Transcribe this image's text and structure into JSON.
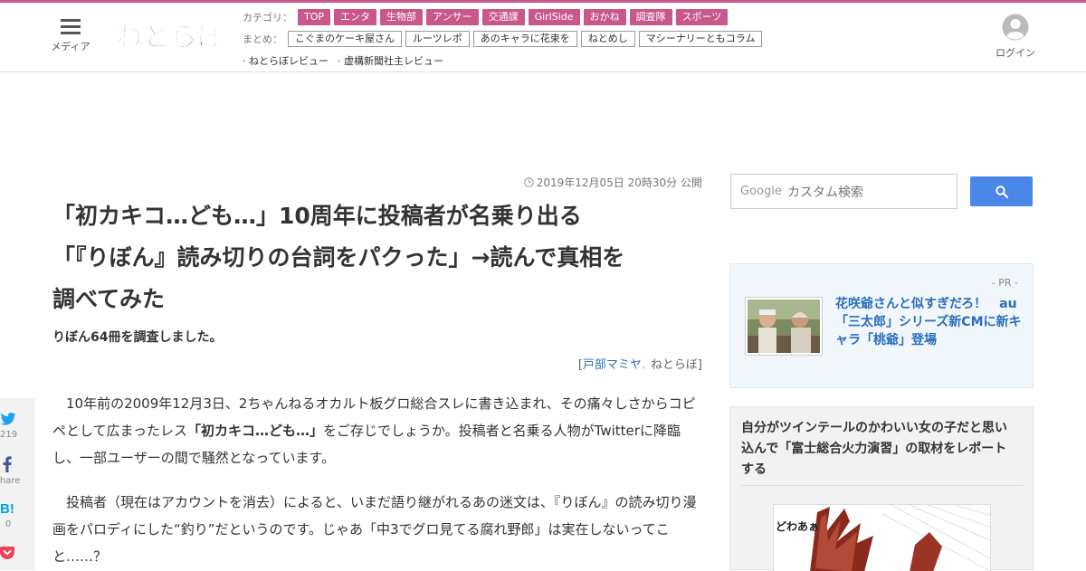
{
  "header": {
    "menu_label": "メディア",
    "logo_text": "ねとらぼ",
    "category_label": "カテゴリ：",
    "categories": [
      "TOP",
      "エンタ",
      "生物部",
      "アンサー",
      "交通課",
      "GirlSide",
      "おかね",
      "調査隊",
      "スポーツ"
    ],
    "summary_label": "まとめ：",
    "summaries": [
      "こぐまのケーキ屋さん",
      "ルーツレポ",
      "あのキャラに花束を",
      "ねとめし",
      "マシーナリーともコラム"
    ],
    "reviews": [
      "· ねとらぼレビュー",
      "· 虚構新聞社主レビュー"
    ],
    "login_label": "ログイン"
  },
  "article": {
    "date": "2019年12月05日 20時30分 公開",
    "title_lines": [
      "「初カキコ…ども…」10周年に投稿者が名乗り出る",
      "「『りぼん』読み切りの台詞をパクった」→読んで真相を",
      "調べてみた"
    ],
    "subtitle": "りぼん64冊を調査しました。",
    "byline_open": "[",
    "author": "戸部マミヤ",
    "sep": "，",
    "outlet": "ねとらぼ",
    "byline_close": "]",
    "p1_a": "10年前の2009年12月3日、2ちゃんねるオカルト板グロ総合スレに書き込まれ、その痛々しさからコピペとして広まったレス",
    "p1_b": "「初カキコ…ども…」",
    "p1_c": "をご存じでしょうか。投稿者と名乗る人物がTwitterに降臨し、一部ユーザーの間で騒然となっています。",
    "p2": "投稿者（現在はアカウントを消去）によると、いまだ語り継がれるあの迷文は、『りぼん』の読み切り漫画をパロディにした“釣り”だというのです。じゃあ「中3でグロ見てる腐れ野郎」は実在しないってこと……？"
  },
  "share": {
    "twitter_count": "219",
    "facebook_label": "Share",
    "hatena_label": "B!",
    "hatena_count": "0"
  },
  "search": {
    "google_label": "Google",
    "placeholder": "カスタム検索"
  },
  "pr": {
    "label": "- PR -",
    "text": "花咲爺さんと似すぎだろ！　au「三太郎」シリーズ新CMに新キャラ「桃爺」登場"
  },
  "recommend": {
    "title": "自分がツインテールのかわいい女の子だと思い込んで「富士総合火力演習」の取材をレポートする",
    "image_text": "どわあぁ"
  },
  "colors": {
    "brand_pink": "#c8578c",
    "link_blue": "#2a6ebb",
    "search_blue": "#4a87e8",
    "twitter_blue": "#1da1f2",
    "facebook_blue": "#3b5998",
    "hatena_blue": "#00a4de",
    "pocket_red": "#ef4056"
  },
  "icons": [
    "hamburger-icon",
    "user-icon",
    "clock-icon",
    "search-icon",
    "twitter-icon",
    "facebook-icon",
    "hatena-icon",
    "pocket-icon"
  ]
}
